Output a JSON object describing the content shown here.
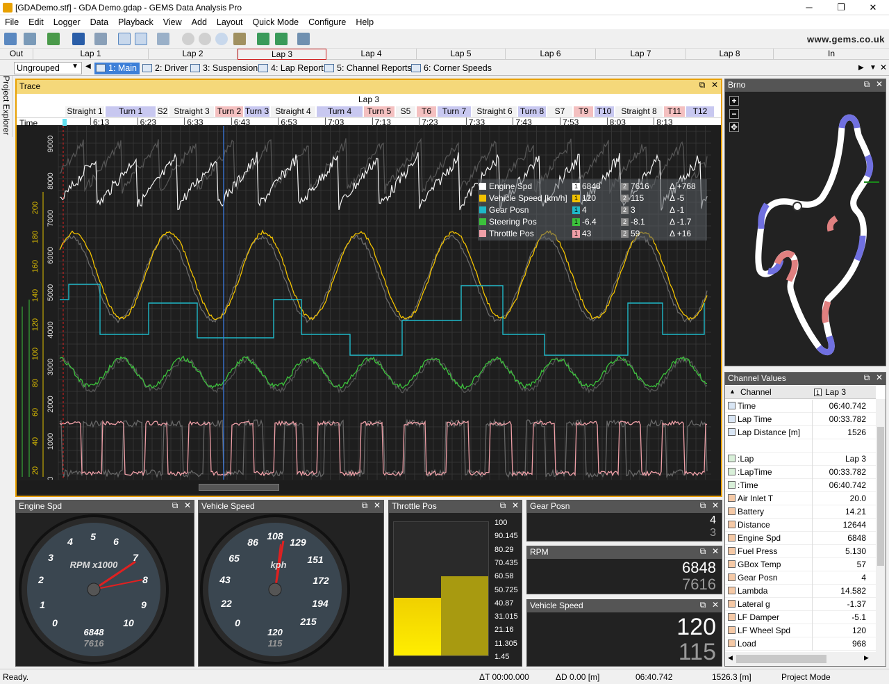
{
  "window": {
    "title": "[GDADemo.stf] - GDA Demo.gdap - GEMS Data Analysis Pro",
    "minimize": "─",
    "maximize": "❐",
    "close": "✕"
  },
  "menu": [
    "File",
    "Edit",
    "Logger",
    "Data",
    "Playback",
    "View",
    "Add",
    "Layout",
    "Quick Mode",
    "Configure",
    "Help"
  ],
  "url": "www.gems.co.uk",
  "laps": [
    "Out",
    "Lap 1",
    "Lap 2",
    "Lap 3",
    "Lap 4",
    "Lap 5",
    "Lap 6",
    "Lap 7",
    "Lap 8",
    "In"
  ],
  "group_select": "Ungrouped",
  "worksheet_tabs": [
    "1: Main",
    "2: Driver",
    "3: Suspension",
    "4: Lap Report",
    "5: Channel Reports",
    "6: Corner Speeds"
  ],
  "project_explorer": "Project Explorer",
  "trace": {
    "title": "Trace",
    "lap_label": "Lap 3",
    "segments": [
      {
        "name": "Straight 1",
        "kind": "straight"
      },
      {
        "name": "Turn 1",
        "kind": "turn"
      },
      {
        "name": "S2",
        "kind": "straight"
      },
      {
        "name": "Straight 3",
        "kind": "straight"
      },
      {
        "name": "Turn 2",
        "kind": "turnred"
      },
      {
        "name": "Turn 3",
        "kind": "turn"
      },
      {
        "name": "Straight 4",
        "kind": "straight"
      },
      {
        "name": "Turn 4",
        "kind": "turn"
      },
      {
        "name": "Turn 5",
        "kind": "turnred"
      },
      {
        "name": "S5",
        "kind": "straight"
      },
      {
        "name": "T6",
        "kind": "turnred"
      },
      {
        "name": "Turn 7",
        "kind": "turn"
      },
      {
        "name": "Straight 6",
        "kind": "straight"
      },
      {
        "name": "Turn 8",
        "kind": "turn"
      },
      {
        "name": "S7",
        "kind": "straight"
      },
      {
        "name": "T9",
        "kind": "turnred"
      },
      {
        "name": "T10",
        "kind": "turn"
      },
      {
        "name": "Straight 8",
        "kind": "straight"
      },
      {
        "name": "T11",
        "kind": "turnred"
      },
      {
        "name": "T12",
        "kind": "turn"
      }
    ],
    "time_label": "Time",
    "time_ticks": [
      "6:13",
      "6:23",
      "6:33",
      "6:43",
      "6:53",
      "7:03",
      "7:13",
      "7:23",
      "7:33",
      "7:43",
      "7:53",
      "8:03",
      "8:13"
    ],
    "axis_rpm": [
      "9000",
      "8000",
      "7000",
      "6000",
      "5000",
      "4000",
      "3000",
      "2000",
      "1000",
      "0"
    ],
    "axis_speed": [
      "200",
      "180",
      "160",
      "140",
      "120",
      "100",
      "80",
      "60",
      "40",
      "20",
      "0"
    ],
    "legend": [
      {
        "name": "Engine Spd",
        "color": "#ffffff",
        "v1": "6848",
        "v2": "7616",
        "delta": "Δ +768"
      },
      {
        "name": "Vehicle Speed [km/h]",
        "color": "#f2c200",
        "v1": "120",
        "v2": "115",
        "delta": "Δ -5"
      },
      {
        "name": "Gear Posn",
        "color": "#1fb8c8",
        "v1": "4",
        "v2": "3",
        "delta": "Δ -1"
      },
      {
        "name": "Steering Pos",
        "color": "#3cc23c",
        "v1": "-6.4",
        "v2": "-8.1",
        "delta": "Δ -1.7"
      },
      {
        "name": "Throttle Pos",
        "color": "#f0a0a8",
        "v1": "43",
        "v2": "59",
        "delta": "Δ +16"
      }
    ],
    "lap_marker_1": "1",
    "lap_marker_2": "2"
  },
  "map": {
    "title": "Brno",
    "zoom_in": "+",
    "zoom_out": "−",
    "pan": "✥"
  },
  "channel_values": {
    "title": "Channel Values",
    "col_channel": "Channel",
    "col_lap_num": "1",
    "col_lap": "Lap 3",
    "rows": [
      {
        "name": "Time",
        "value": "06:40.742"
      },
      {
        "name": "Lap Time",
        "value": "00:33.782"
      },
      {
        "name": "Lap Distance [m]",
        "value": "1526"
      },
      {
        "name": "",
        "value": ""
      },
      {
        "name": ":Lap",
        "value": "Lap 3"
      },
      {
        "name": ":LapTime",
        "value": "00:33.782"
      },
      {
        "name": ":Time",
        "value": "06:40.742"
      },
      {
        "name": "Air Inlet T",
        "value": "20.0"
      },
      {
        "name": "Battery",
        "value": "14.21"
      },
      {
        "name": "Distance",
        "value": "12644"
      },
      {
        "name": "Engine Spd",
        "value": "6848"
      },
      {
        "name": "Fuel Press",
        "value": "5.130"
      },
      {
        "name": "GBox Temp",
        "value": "57"
      },
      {
        "name": "Gear Posn",
        "value": "4"
      },
      {
        "name": "Lambda",
        "value": "14.582"
      },
      {
        "name": "Lateral g",
        "value": "-1.37"
      },
      {
        "name": "LF Damper",
        "value": "-5.1"
      },
      {
        "name": "LF Wheel Spd",
        "value": "120"
      },
      {
        "name": "Load",
        "value": "968"
      }
    ]
  },
  "gauges": {
    "engine": {
      "title": "Engine Spd",
      "unit": "RPM x1000",
      "ticks": [
        "0",
        "1",
        "2",
        "3",
        "4",
        "5",
        "6",
        "7",
        "8",
        "9",
        "10"
      ],
      "v1": "6848",
      "v2": "7616"
    },
    "speed": {
      "title": "Vehicle Speed",
      "unit": "kph",
      "ticks": [
        "0",
        "22",
        "43",
        "65",
        "86",
        "108",
        "129",
        "151",
        "172",
        "194",
        "215"
      ],
      "v1": "120",
      "v2": "115"
    }
  },
  "throttle": {
    "title": "Throttle Pos",
    "scale": [
      "100",
      "90.145",
      "80.29",
      "70.435",
      "60.58",
      "50.725",
      "40.87",
      "31.015",
      "21.16",
      "11.305",
      "1.45"
    ],
    "v1_pct": 43,
    "v2_pct": 59
  },
  "gear": {
    "title": "Gear Posn",
    "v1": "4",
    "v2": "3"
  },
  "rpm": {
    "title": "RPM",
    "v1": "6848",
    "v2": "7616"
  },
  "vspeed": {
    "title": "Vehicle Speed",
    "v1": "120",
    "v2": "115"
  },
  "status": {
    "ready": "Ready.",
    "dt": "ΔT 00:00.000",
    "dd": "ΔD 0.00 [m]",
    "time": "06:40.742",
    "dist": "1526.3 [m]",
    "mode": "Project Mode"
  }
}
